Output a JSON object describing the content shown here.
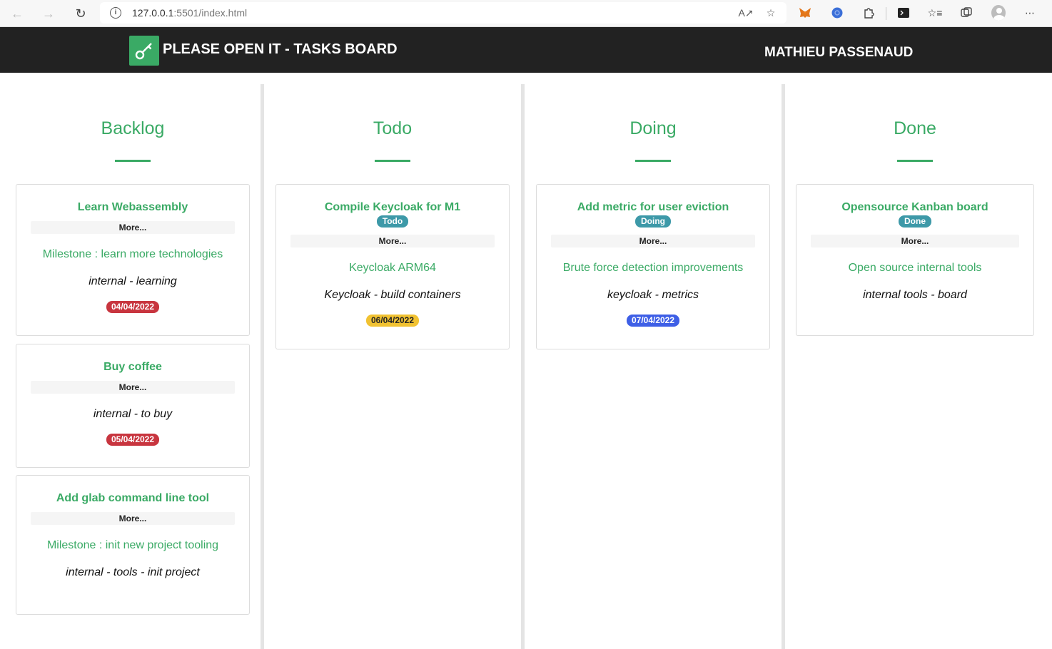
{
  "browser": {
    "url_host": "127.0.0.1",
    "url_rest": ":5501/index.html"
  },
  "app": {
    "title": "PLEASE OPEN IT - TASKS BOARD",
    "user": "MATHIEU PASSENAUD",
    "accent_color": "#3aaa65"
  },
  "columns": [
    {
      "title": "Backlog",
      "cards": [
        {
          "title": "Learn Webassembly",
          "more": "More...",
          "milestone": "Milestone : learn more technologies",
          "labels": "internal - learning",
          "date": "04/04/2022"
        },
        {
          "title": "Buy coffee",
          "more": "More...",
          "labels": "internal - to buy",
          "date": "05/04/2022"
        },
        {
          "title": "Add glab command line tool",
          "more": "More...",
          "milestone": "Milestone : init new project tooling",
          "labels": "internal - tools - init project"
        }
      ]
    },
    {
      "title": "Todo",
      "cards": [
        {
          "title": "Compile Keycloak for M1",
          "status": "Todo",
          "more": "More...",
          "milestone": "Keycloak ARM64",
          "labels": "Keycloak - build containers",
          "date": "06/04/2022"
        }
      ]
    },
    {
      "title": "Doing",
      "cards": [
        {
          "title": "Add metric for user eviction",
          "status": "Doing",
          "more": "More...",
          "milestone": "Brute force detection improvements",
          "labels": "keycloak - metrics",
          "date": "07/04/2022"
        }
      ]
    },
    {
      "title": "Done",
      "cards": [
        {
          "title": "Opensource Kanban board",
          "status": "Done",
          "more": "More...",
          "milestone": "Open source internal tools",
          "labels": "internal tools - board"
        }
      ]
    }
  ]
}
